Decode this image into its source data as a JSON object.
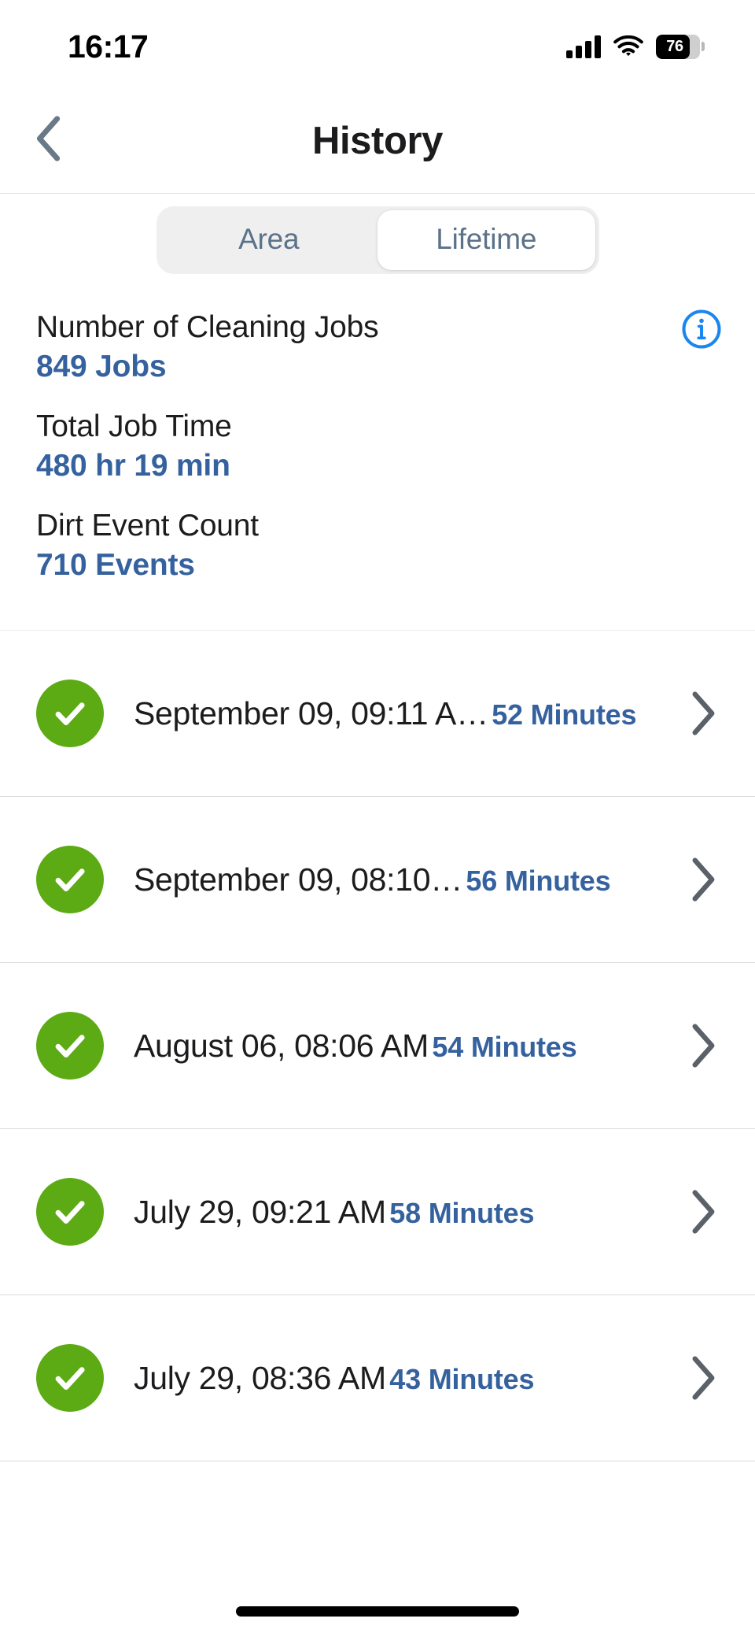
{
  "status_bar": {
    "time": "16:17",
    "battery_percent": "76",
    "signal_icon": "cellular-signal-icon",
    "wifi_icon": "wifi-icon",
    "battery_icon": "battery-icon"
  },
  "nav": {
    "title": "History",
    "back_icon": "chevron-left-icon"
  },
  "segments": {
    "items": [
      {
        "label": "Area",
        "active": false
      },
      {
        "label": "Lifetime",
        "active": true
      }
    ]
  },
  "stats": {
    "info_icon": "info-circle-icon",
    "items": [
      {
        "label": "Number of Cleaning Jobs",
        "value": "849 Jobs"
      },
      {
        "label": "Total Job Time",
        "value": "480 hr 19 min"
      },
      {
        "label": "Dirt Event Count",
        "value": "710 Events"
      }
    ]
  },
  "history": {
    "rows": [
      {
        "status_icon": "check-circle-icon",
        "title": "September 09, 09:11 A…",
        "duration": "52 Minutes",
        "chevron_icon": "chevron-right-icon"
      },
      {
        "status_icon": "check-circle-icon",
        "title": "September 09, 08:10…",
        "duration": "56 Minutes",
        "chevron_icon": "chevron-right-icon"
      },
      {
        "status_icon": "check-circle-icon",
        "title": "August 06, 08:06 AM",
        "duration": "54 Minutes",
        "chevron_icon": "chevron-right-icon"
      },
      {
        "status_icon": "check-circle-icon",
        "title": "July 29, 09:21 AM",
        "duration": "58 Minutes",
        "chevron_icon": "chevron-right-icon"
      },
      {
        "status_icon": "check-circle-icon",
        "title": "July 29, 08:36 AM",
        "duration": "43 Minutes",
        "chevron_icon": "chevron-right-icon"
      }
    ]
  },
  "home_indicator": {
    "label": "home-indicator"
  },
  "colors": {
    "accent_blue": "#35629f",
    "info_blue": "#1a87f0",
    "success_green": "#5cab14",
    "segment_text": "#5b7288",
    "chevron_gray": "#5b6168",
    "back_chevron": "#6a7988"
  }
}
